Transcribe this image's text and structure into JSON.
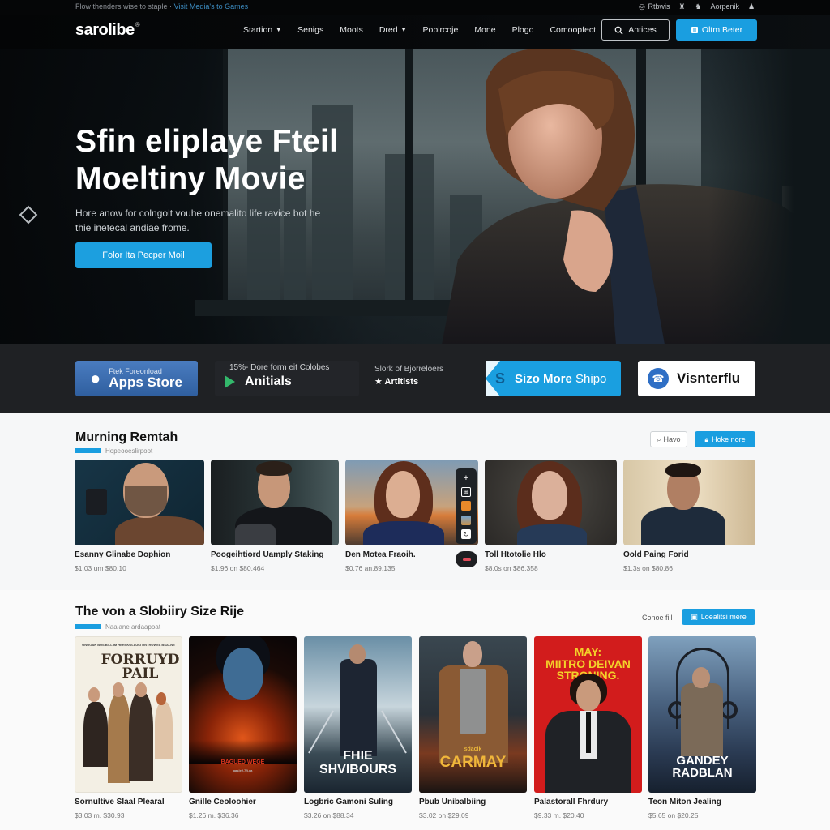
{
  "notice": {
    "text": "Flow thenders wise to staple ·",
    "link": "Visit Media's to Games",
    "right_items": [
      {
        "icon": "globe-icon",
        "label": "Rtbwis"
      },
      {
        "icon": "trophy-icon",
        "label": ""
      },
      {
        "icon": "tooth-icon",
        "label": ""
      },
      {
        "icon": "",
        "label": "Aorpenik"
      },
      {
        "icon": "user-icon",
        "label": ""
      }
    ]
  },
  "header": {
    "logo": "sarolibe",
    "logo_mark": "®",
    "nav": [
      {
        "label": "Startion",
        "dropdown": true
      },
      {
        "label": "Senigs",
        "dropdown": false
      },
      {
        "label": "Moots",
        "dropdown": false
      },
      {
        "label": "Dred",
        "dropdown": true
      },
      {
        "label": "Popircoje",
        "dropdown": false
      },
      {
        "label": "Mone",
        "dropdown": false
      },
      {
        "label": "Plogo",
        "dropdown": false
      },
      {
        "label": "Comoopfect",
        "dropdown": false
      }
    ],
    "search_label": "Antices",
    "cta_label": "Oltm Beter",
    "accent": "#1a9ee0"
  },
  "hero": {
    "title_line1": "Sfin eliplaye Fteil",
    "title_line2": "Moeltiny Movie",
    "subtitle": "Hore anow for colngolt vouhe onemalito life ravice bot he thie inetecal andiae frome.",
    "button": "Folor Ita Pecper Moil"
  },
  "stores": {
    "apple": {
      "line1": "Ftek Foreonload",
      "line2": "Apps Store"
    },
    "play": {
      "line1": "15%- Dore form eit Colobes",
      "line2": "Anitials"
    },
    "artists": {
      "line1": "Slork of Bjorreloers",
      "line2": "Artitists"
    },
    "ship": {
      "line2a": "Sizo More",
      "line2b": "Shipo"
    },
    "visnter": {
      "line2": "Visnterflu"
    }
  },
  "section1": {
    "title": "Murning Remtah",
    "subtitle": "Hopeooeslirpoot",
    "ghost_button": "Havo",
    "blue_button": "Hoke nore",
    "cards": [
      {
        "name": "Esanny Glinabe Dophion",
        "price": "$1.03  um $80.10"
      },
      {
        "name": "Poogeihtiord Uamply Staking",
        "price": "$1.96  on $80.464"
      },
      {
        "name": "Den Motea Fraoih.",
        "price": "$0.76  an.89.135"
      },
      {
        "name": "Toll Htotolie Hlo",
        "price": "$8.0s  on $86.358"
      },
      {
        "name": "Oold Paing Forid",
        "price": "$1.3s  on $80.86"
      }
    ],
    "toolbar_icons": [
      "plus-icon",
      "grid-icon",
      "layers-icon",
      "image-icon",
      "refresh-icon"
    ]
  },
  "section2": {
    "title": "The von a Slobiiry Size Rije",
    "subtitle": "Naalane ardaapoat",
    "link": "Conoe fill",
    "blue_button": "Loealitsi mere",
    "posters": [
      {
        "poster_title": "FORRUYD\nPAIL",
        "tagline": "ONOOAK BUS BILL IM HERSKOLLUCI DNTROWEL BSALNE",
        "name": "Sornultive Slaal Plearal",
        "price": "$3.03  m. $30.93"
      },
      {
        "poster_title": "BAGUED WEGE",
        "tagline": "pasle2.7fi.ea",
        "name": "Gnille Ceoloohier",
        "price": "$1.26  m. $36.36"
      },
      {
        "poster_title": "FHIE\nSHVIBOURS",
        "tagline": "",
        "name": "Logbric Gamoni Suling",
        "price": "$3.26  on $88.34"
      },
      {
        "poster_title": "CARMAY",
        "tagline": "sdacik",
        "name": "Pbub Unibalbiing",
        "price": "$3.02  on $29.09"
      },
      {
        "poster_title": "MAY:\nMIITRO DEIVAN\nSTRONING.",
        "tagline": "",
        "name": "Palastorall Fhrdury",
        "price": "$9.33  m. $20.40"
      },
      {
        "poster_title": "GANDEY RADBLAN",
        "tagline": "",
        "name": "Teon Miton Jealing",
        "price": "$5.65  on $20.25"
      }
    ]
  }
}
